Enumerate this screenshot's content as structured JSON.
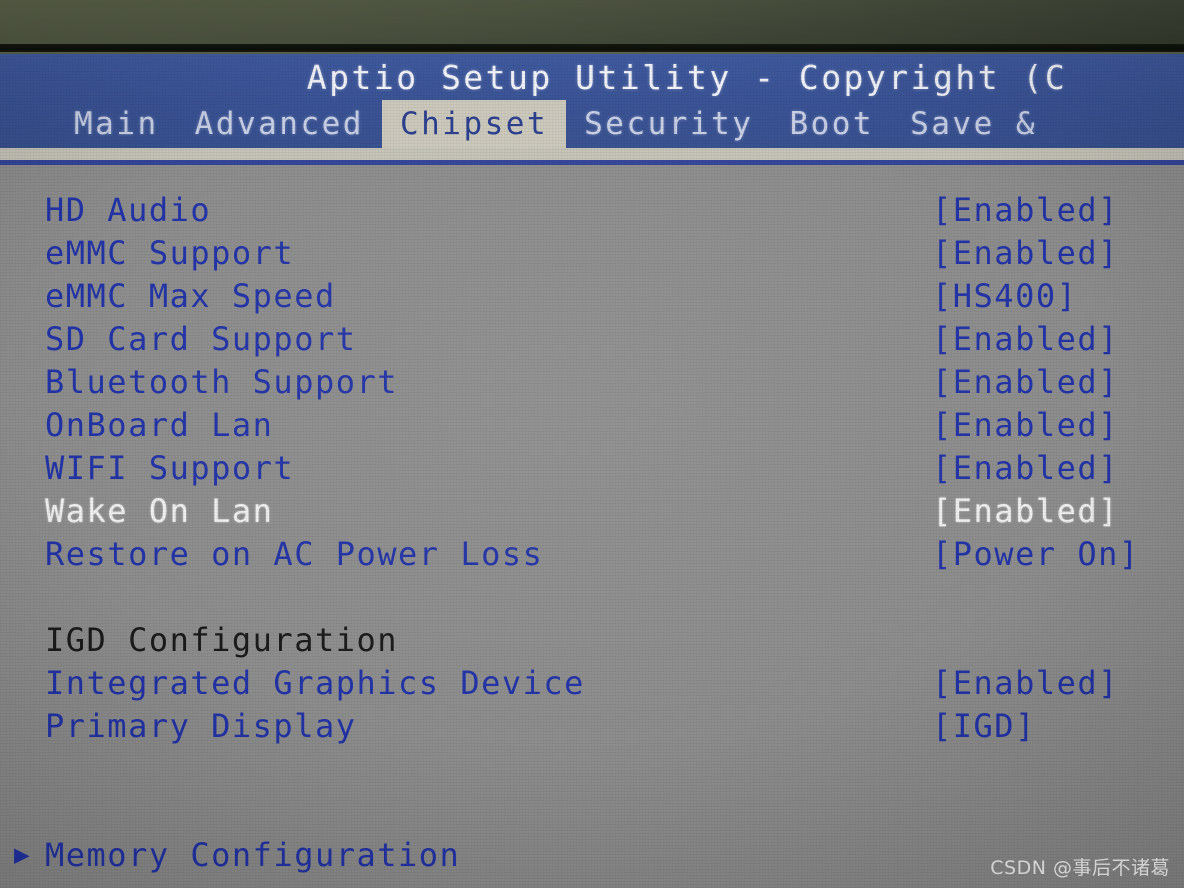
{
  "window": {
    "title": "Aptio Setup Utility - Copyright (C",
    "bezel_color": "#4d5440",
    "header_color": "#3c5599",
    "content_color": "#8d8d8d",
    "text_color": "#2233a8",
    "dim_text_color": "#f0f0f0",
    "active_tab_color": "#ccc9bc"
  },
  "menubar": {
    "tabs": [
      {
        "label": "Main",
        "active": false
      },
      {
        "label": "Advanced",
        "active": false
      },
      {
        "label": "Chipset",
        "active": true
      },
      {
        "label": "Security",
        "active": false
      },
      {
        "label": "Boot",
        "active": false
      },
      {
        "label": "Save &",
        "active": false
      }
    ]
  },
  "settings": {
    "rows": [
      {
        "label": "HD Audio",
        "value": "[Enabled]",
        "state": "normal",
        "submenu": false
      },
      {
        "label": "eMMC Support",
        "value": "[Enabled]",
        "state": "normal",
        "submenu": false
      },
      {
        "label": "eMMC Max Speed",
        "value": "[HS400]",
        "state": "normal",
        "submenu": false
      },
      {
        "label": "SD Card Support",
        "value": "[Enabled]",
        "state": "normal",
        "submenu": false
      },
      {
        "label": "Bluetooth Support",
        "value": "[Enabled]",
        "state": "normal",
        "submenu": false
      },
      {
        "label": "OnBoard Lan",
        "value": "[Enabled]",
        "state": "normal",
        "submenu": false
      },
      {
        "label": "WIFI Support",
        "value": "[Enabled]",
        "state": "normal",
        "submenu": false
      },
      {
        "label": "Wake On Lan",
        "value": "[Enabled]",
        "state": "dim",
        "submenu": false
      },
      {
        "label": "Restore on AC Power Loss",
        "value": "[Power On]",
        "state": "normal",
        "submenu": false
      },
      {
        "label": "",
        "value": "",
        "state": "spacer",
        "submenu": false
      },
      {
        "label": "IGD Configuration",
        "value": "",
        "state": "section",
        "submenu": false
      },
      {
        "label": "Integrated Graphics Device",
        "value": "[Enabled]",
        "state": "normal",
        "submenu": false
      },
      {
        "label": "Primary Display",
        "value": "[IGD]",
        "state": "normal",
        "submenu": false
      },
      {
        "label": "",
        "value": "",
        "state": "spacer",
        "submenu": false
      },
      {
        "label": "",
        "value": "",
        "state": "spacer",
        "submenu": false
      },
      {
        "label": "Memory Configuration",
        "value": "",
        "state": "normal",
        "submenu": true
      }
    ]
  },
  "watermark": {
    "text": "CSDN @事后不诸葛"
  }
}
